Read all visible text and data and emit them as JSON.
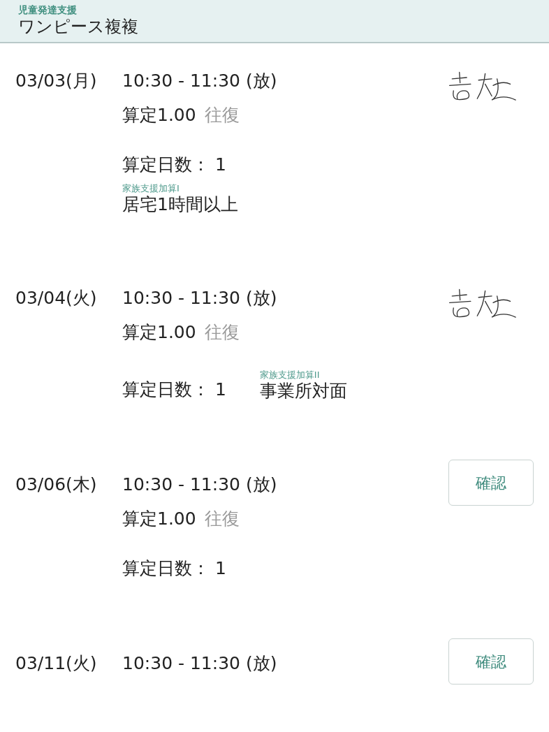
{
  "header": {
    "subtitle": "児童発達支援",
    "title": "ワンピース複複"
  },
  "entries": [
    {
      "date": "03/03(月)",
      "time": "10:30 - 11:30  (放)",
      "calc": "算定1.00",
      "transport": "往復",
      "days": "算定日数： 1",
      "addition": {
        "kind": "block",
        "label": "家族支援加算I",
        "value": "居宅1時間以上"
      },
      "confirmation": {
        "kind": "signature"
      }
    },
    {
      "date": "03/04(火)",
      "time": "10:30 - 11:30  (放)",
      "calc": "算定1.00",
      "transport": "往復",
      "days": "算定日数： 1",
      "addition": {
        "kind": "inline",
        "label": "家族支援加算II",
        "value": "事業所対面"
      },
      "confirmation": {
        "kind": "signature"
      }
    },
    {
      "date": "03/06(木)",
      "time": "10:30 - 11:30  (放)",
      "calc": "算定1.00",
      "transport": "往復",
      "days": "算定日数： 1",
      "confirmation": {
        "kind": "button",
        "label": "確認"
      }
    },
    {
      "date": "03/11(火)",
      "time": "10:30 - 11:30  (放)",
      "confirmation": {
        "kind": "button",
        "label": "確認"
      }
    }
  ]
}
